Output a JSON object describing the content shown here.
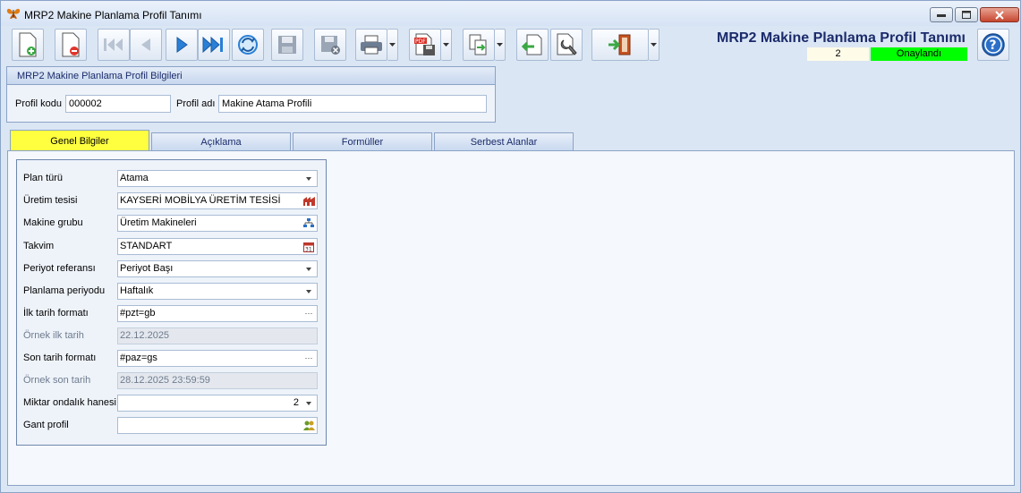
{
  "window": {
    "title": "MRP2 Makine Planlama Profil Tanımı"
  },
  "header": {
    "title": "MRP2 Makine Planlama Profil Tanımı",
    "record_count": "2",
    "status": "Onaylandı",
    "status_color": "#00ff00"
  },
  "toolbar": {
    "icons": [
      "new-document-icon",
      "delete-document-icon",
      "first-record-icon",
      "previous-record-icon",
      "next-record-icon",
      "last-record-icon",
      "refresh-icon",
      "save-icon",
      "save-close-icon",
      "print-icon",
      "pdf-icon",
      "export-icon",
      "import-icon",
      "settings-icon",
      "exit-icon",
      "help-icon"
    ]
  },
  "profile": {
    "group_title": "MRP2 Makine Planlama Profil Bilgileri",
    "code_label": "Profil kodu",
    "code_value": "000002",
    "name_label": "Profil adı",
    "name_value": "Makine Atama Profili"
  },
  "tabs": [
    {
      "label": "Genel Bilgiler",
      "active": true
    },
    {
      "label": "Açıklama",
      "active": false
    },
    {
      "label": "Formüller",
      "active": false
    },
    {
      "label": "Serbest Alanlar",
      "active": false
    }
  ],
  "form": {
    "rows": [
      {
        "label": "Plan türü",
        "value": "Atama"
      },
      {
        "label": "Üretim tesisi",
        "value": "KAYSERİ MOBİLYA ÜRETİM TESİSİ"
      },
      {
        "label": "Makine grubu",
        "value": "Üretim Makineleri"
      },
      {
        "label": "Takvim",
        "value": "STANDART"
      },
      {
        "label": "Periyot referansı",
        "value": "Periyot Başı"
      },
      {
        "label": "Planlama periyodu",
        "value": "Haftalık"
      },
      {
        "label": "İlk tarih formatı",
        "value": "#pzt=gb"
      },
      {
        "label": "Örnek ilk tarih",
        "value": "22.12.2025"
      },
      {
        "label": "Son tarih formatı",
        "value": "#paz=gs"
      },
      {
        "label": "Örnek son tarih",
        "value": "28.12.2025 23:59:59"
      },
      {
        "label": "Miktar ondalık hanesi",
        "value": "2"
      },
      {
        "label": "Gant profil",
        "value": ""
      }
    ]
  }
}
